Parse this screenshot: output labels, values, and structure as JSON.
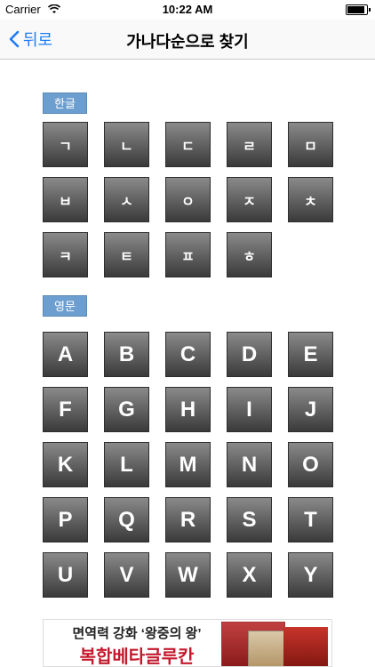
{
  "status": {
    "carrier": "Carrier",
    "time": "10:22 AM",
    "battery_level": 0.95
  },
  "nav": {
    "back_label": "뒤로",
    "title": "가나다순으로 찾기"
  },
  "sections": {
    "korean_label": "한글",
    "english_label": "영문"
  },
  "korean_keys": [
    "ㄱ",
    "ㄴ",
    "ㄷ",
    "ㄹ",
    "ㅁ",
    "ㅂ",
    "ㅅ",
    "ㅇ",
    "ㅈ",
    "ㅊ",
    "ㅋ",
    "ㅌ",
    "ㅍ",
    "ㅎ"
  ],
  "english_keys": [
    "A",
    "B",
    "C",
    "D",
    "E",
    "F",
    "G",
    "H",
    "I",
    "J",
    "K",
    "L",
    "M",
    "N",
    "O",
    "P",
    "Q",
    "R",
    "S",
    "T",
    "U",
    "V",
    "W",
    "X",
    "Y"
  ],
  "ad": {
    "line1": "면역력 강화 ‘왕중의 왕’",
    "line2": "복합베타글루칸"
  }
}
